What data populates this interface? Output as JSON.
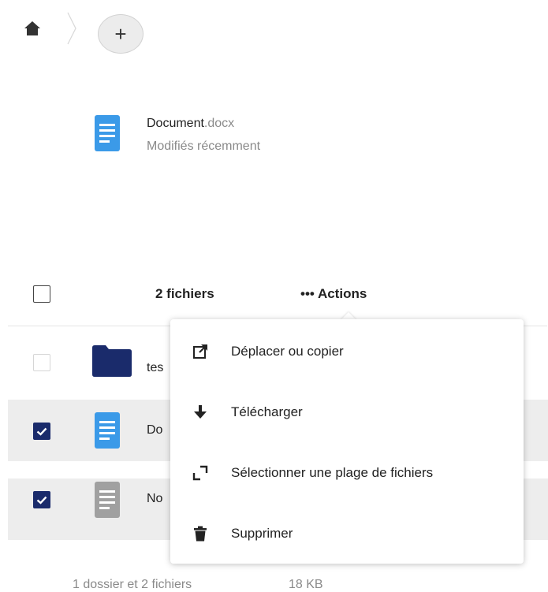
{
  "breadcrumb": {
    "home_icon": "home-icon",
    "add_label": "+"
  },
  "recent": {
    "file_name": "Document",
    "file_ext": ".docx",
    "subtitle": "Modifiés récemment"
  },
  "header": {
    "selected_count": "2 fichiers",
    "actions_label": "••• Actions"
  },
  "rows": [
    {
      "name_partial": "tes",
      "type": "folder",
      "checked": false
    },
    {
      "name_partial": "Do",
      "type": "document",
      "checked": true
    },
    {
      "name_partial": "No",
      "type": "text",
      "checked": true
    }
  ],
  "menu": {
    "items": [
      {
        "label": "Déplacer ou copier",
        "icon": "external-link-icon"
      },
      {
        "label": "Télécharger",
        "icon": "download-icon"
      },
      {
        "label": "Sélectionner une plage de fichiers",
        "icon": "select-range-icon"
      },
      {
        "label": "Supprimer",
        "icon": "trash-icon"
      }
    ]
  },
  "footer": {
    "summary": "1 dossier et 2 fichiers",
    "size": "18 KB"
  },
  "colors": {
    "checkbox_checked": "#1a2b6b",
    "document_icon": "#3b9ae8",
    "folder_icon": "#1a2b6b",
    "text_icon": "#a0a0a0",
    "selected_row": "#ededed"
  }
}
